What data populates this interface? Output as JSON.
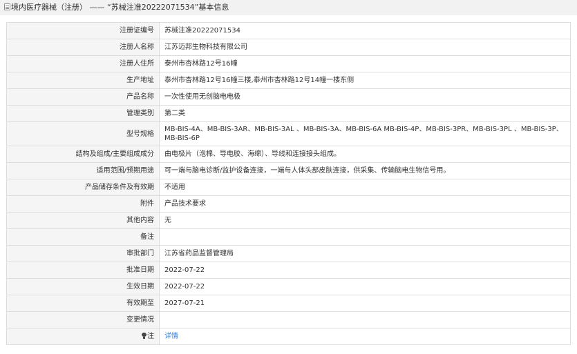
{
  "header": {
    "breadcrumb_root": "境内医疗器械（注册）",
    "separator": "——",
    "title_suffix": "“苏械注准20222071534”基本信息"
  },
  "rows": [
    {
      "label": "注册证编号",
      "value": "苏械注准20222071534"
    },
    {
      "label": "注册人名称",
      "value": "江苏迈邦生物科技有限公司"
    },
    {
      "label": "注册人住所",
      "value": "泰州市杏林路12号16幢"
    },
    {
      "label": "生产地址",
      "value": "泰州市杏林路12号16幢三楼,泰州市杏林路12号14幢一楼东侧"
    },
    {
      "label": "产品名称",
      "value": "一次性使用无创脑电电极"
    },
    {
      "label": "管理类别",
      "value": "第二类"
    },
    {
      "label": "型号规格",
      "value": "MB-BIS-4A、MB-BIS-3AR、MB-BIS-3AL 、MB-BIS-3A、MB-BIS-6A MB-BIS-4P、MB-BIS-3PR、MB-BIS-3PL 、MB-BIS-3P、MB-BIS-6P"
    },
    {
      "label": "结构及组成/主要组成成分",
      "value": "由电极片（泡棉、导电胶、海绵）、导线和连接接头组成。"
    },
    {
      "label": "适用范围/预期用途",
      "value": "可一端与脑电诊断/监护设备连接，一端与人体头部皮肤连接，供采集、传输脑电生物信号用。"
    },
    {
      "label": "产品储存条件及有效期",
      "value": "不适用"
    },
    {
      "label": "附件",
      "value": "产品技术要求"
    },
    {
      "label": "其他内容",
      "value": "无"
    },
    {
      "label": "备注",
      "value": ""
    },
    {
      "label": "审批部门",
      "value": "江苏省药品监督管理局"
    },
    {
      "label": "批准日期",
      "value": "2022-07-22"
    },
    {
      "label": "生效日期",
      "value": "2022-07-22"
    },
    {
      "label": "有效期至",
      "value": "2027-07-21"
    },
    {
      "label": "变更情况",
      "value": ""
    }
  ],
  "note_row": {
    "label": "注",
    "link_text": "详情"
  },
  "colors": {
    "link": "#3a7bd5",
    "label_bg": "#f5f5f5",
    "border": "#dddddd",
    "header_bg": "#f2f2f2"
  }
}
